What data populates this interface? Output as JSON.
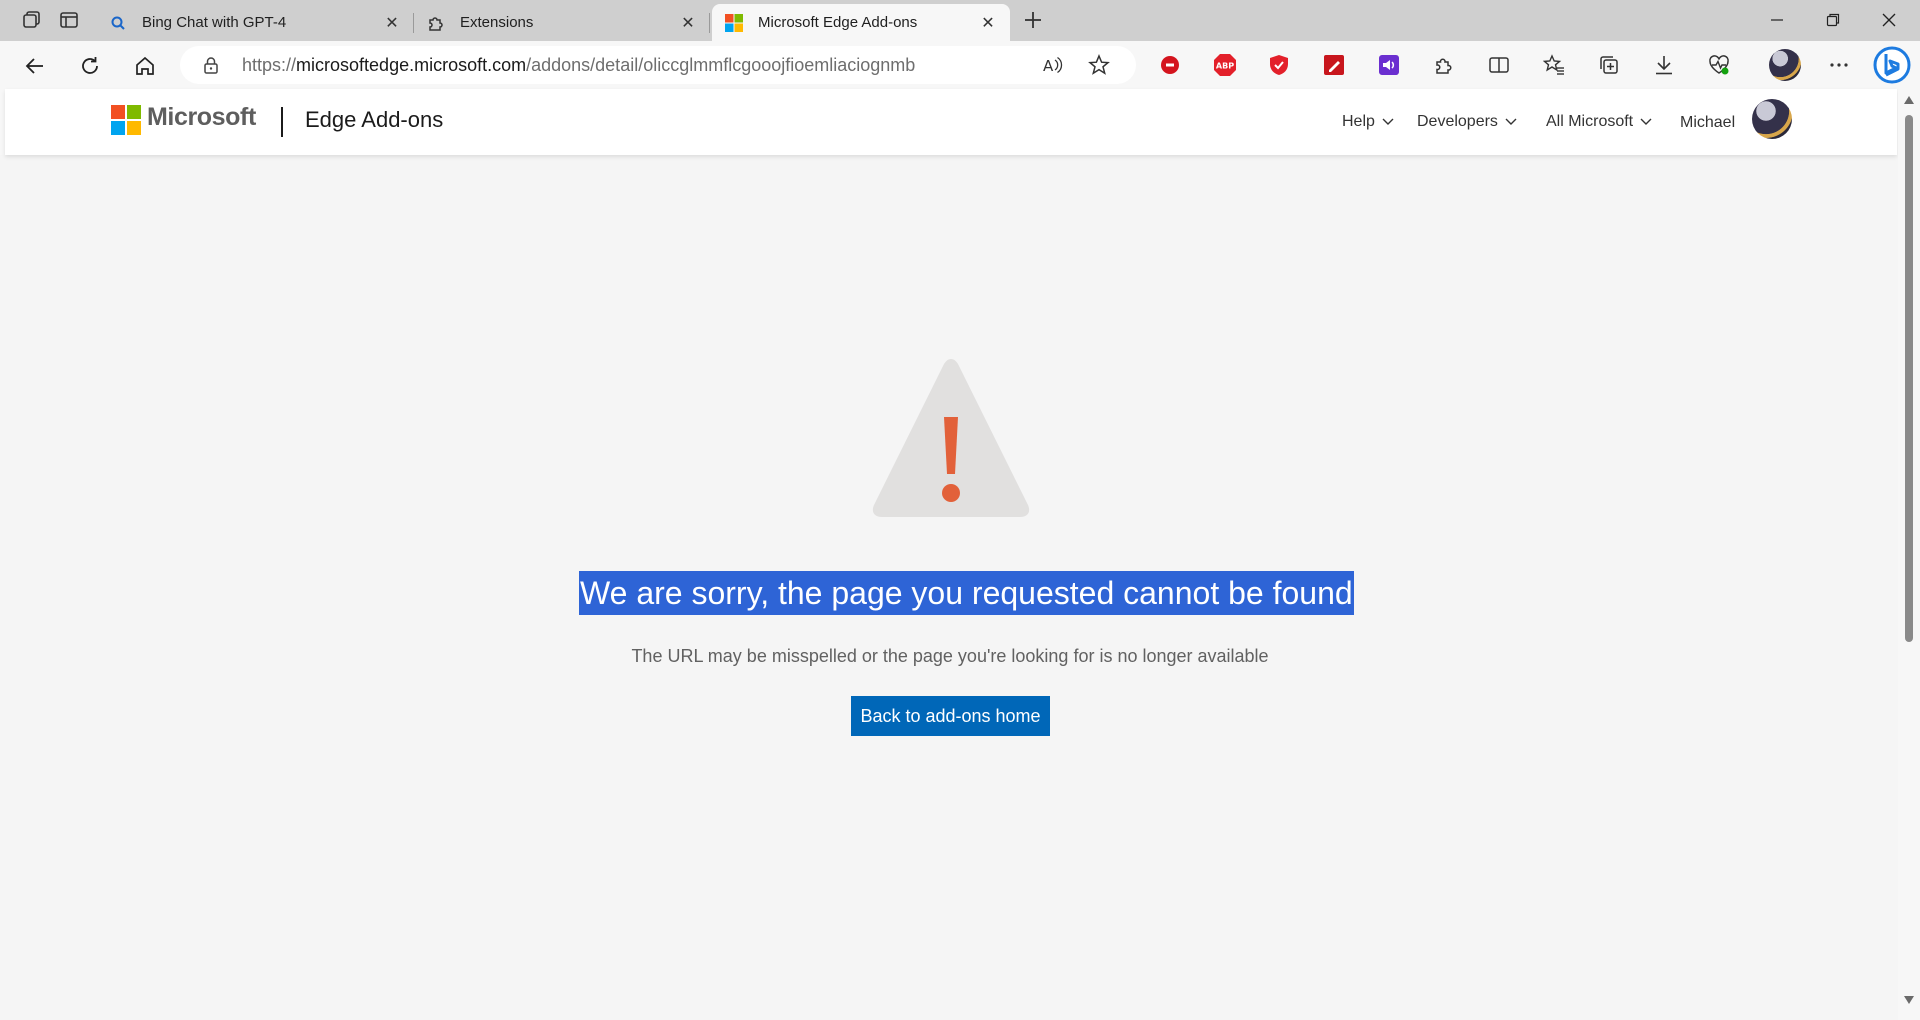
{
  "tabs": [
    {
      "title": "Bing Chat with GPT-4",
      "favicon": "bing-search-icon"
    },
    {
      "title": "Extensions",
      "favicon": "puzzle-icon"
    },
    {
      "title": "Microsoft Edge Add-ons",
      "favicon": "microsoft-logo-icon",
      "active": true
    }
  ],
  "address_bar": {
    "url_scheme": "https://",
    "url_host": "microsoftedge.microsoft.com",
    "url_path": "/addons/detail/oliccglmmflcgooojfioemliaciognmb"
  },
  "site_header": {
    "brand": "Microsoft",
    "site_name": "Edge Add-ons",
    "nav": [
      "Help",
      "Developers",
      "All Microsoft"
    ],
    "user_name": "Michael"
  },
  "error_page": {
    "title": "We are sorry, the page you requested cannot be found",
    "subtitle": "The URL may be misspelled or the page you're looking for is no longer available",
    "button_label": "Back to add-ons home"
  },
  "extension_icons": [
    "red-stop-icon",
    "adblock-plus-icon",
    "shield-icon",
    "red-pen-icon",
    "purple-audio-icon"
  ],
  "colors": {
    "accent": "#0067b8",
    "selection": "#2e64d6",
    "warning": "#e2613a"
  }
}
